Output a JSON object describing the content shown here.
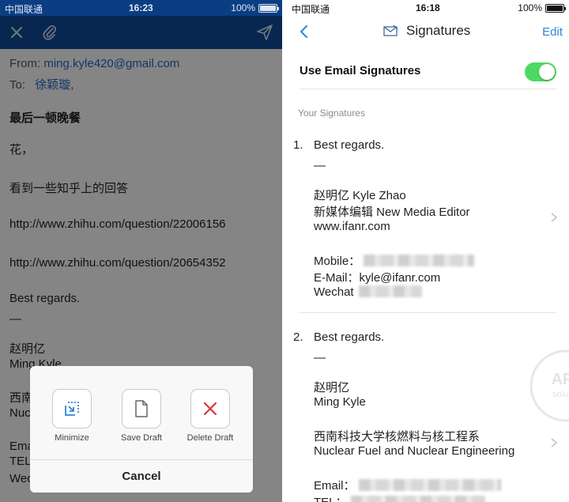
{
  "status_left": {
    "carrier": "中国联通",
    "time": "16:23",
    "battery": "100%"
  },
  "status_right": {
    "carrier": "中国联通",
    "time": "16:18",
    "battery": "100%"
  },
  "compose": {
    "icons": [
      "close-icon",
      "paperclip-icon",
      "send-icon"
    ],
    "from_label": "From:",
    "from_value": "ming.kyle420@gmail.com",
    "to_label": "To:",
    "to_value": "徐颖璇",
    "to_suffix": ",",
    "subject": "最后一顿晚餐",
    "body": {
      "line1": "花，",
      "line2": "看到一些知乎上的回答",
      "line3": "http://www.zhihu.com/question/22006156",
      "line4": "http://www.zhihu.com/question/20654352",
      "line5": "Best regards.",
      "line6": "—",
      "line7": "赵明亿",
      "line8": "Ming Kyle",
      "line9": "西南",
      "line10": "Nuc",
      "line11": "Ema",
      "line12": "TEL",
      "line13": "Wec"
    }
  },
  "action_sheet": {
    "minimize": "Minimize",
    "save_draft": "Save Draft",
    "delete_draft": "Delete Draft",
    "cancel": "Cancel",
    "colors": {
      "primary": "#2f86d6",
      "danger": "#d9363e"
    }
  },
  "signatures": {
    "title": "Signatures",
    "edit": "Edit",
    "toggle_label": "Use Email Signatures",
    "toggle_on": true,
    "section_header": "Your Signatures",
    "items": [
      {
        "num": "1.",
        "greeting": "Best regards.",
        "dash": "—",
        "name": "赵明亿  Kyle Zhao",
        "role": "新媒体编辑  New Media Editor",
        "site": "www.ifanr.com",
        "mobile": "Mobile：",
        "email": "E-Mail：kyle@ifanr.com",
        "wechat": "Wechat"
      },
      {
        "num": "2.",
        "greeting": "Best regards.",
        "dash": "—",
        "name_cn": "赵明亿",
        "name_en": "Ming Kyle",
        "dept_cn": "西南科技大学核燃料与核工程系",
        "dept_en": "Nuclear Fuel and Nuclear Engineering",
        "email": "Email：",
        "tel": "TEL："
      }
    ]
  },
  "watermark": {
    "line1": "APP",
    "line2": "solution"
  },
  "colors": {
    "compose_bar": "#0e4c9c",
    "status_bar": "#0b3d83",
    "link": "#1d69c9",
    "toggle": "#4cd964"
  }
}
